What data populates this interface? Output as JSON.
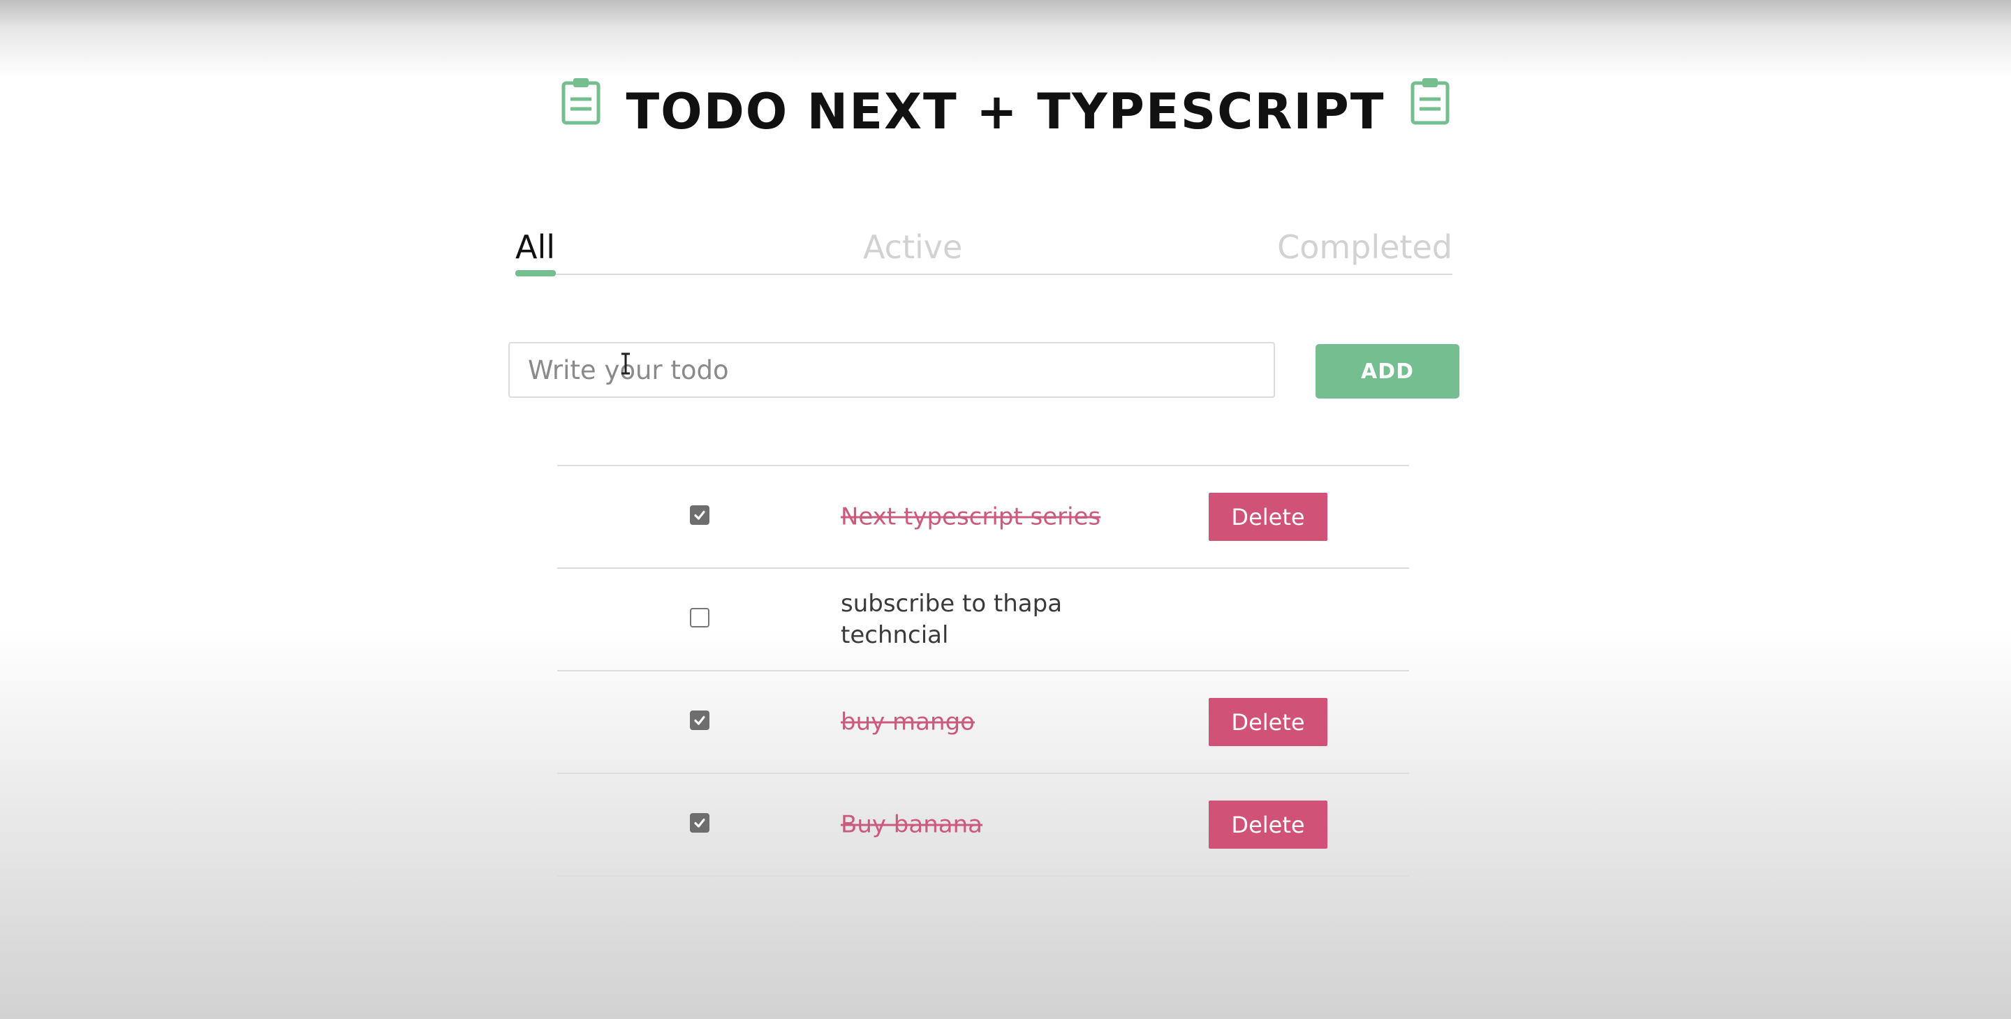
{
  "app": {
    "title": "TODO NEXT + TYPESCRIPT",
    "title_icon": "clipboard-icon"
  },
  "colors": {
    "accent": "#74be8f",
    "danger": "#d05377",
    "done_text": "#cb5b7c"
  },
  "tabs": [
    {
      "label": "All",
      "selected": true
    },
    {
      "label": "Active",
      "selected": false
    },
    {
      "label": "Completed",
      "selected": false
    }
  ],
  "input": {
    "placeholder": "Write your todo",
    "value": ""
  },
  "add_button": {
    "label": "ADD"
  },
  "todos": [
    {
      "text": "Next typescript series",
      "completed": true,
      "delete_label": "Delete"
    },
    {
      "text": "subscribe to thapa techncial",
      "completed": false,
      "delete_label": ""
    },
    {
      "text": "buy mango",
      "completed": true,
      "delete_label": "Delete"
    },
    {
      "text": "Buy banana",
      "completed": true,
      "delete_label": "Delete"
    }
  ]
}
